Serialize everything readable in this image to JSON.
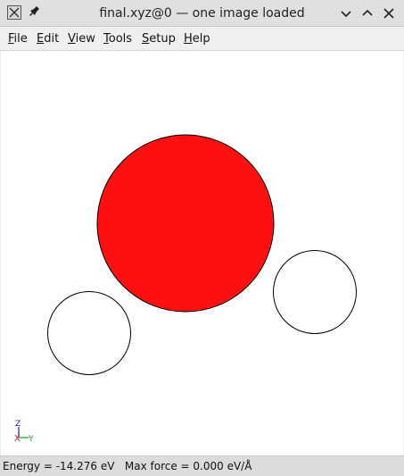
{
  "window": {
    "title": "final.xyz@0 — one image loaded",
    "app_icon": "ase-app-icon",
    "pin_icon": "pin-icon"
  },
  "menu": {
    "items": [
      {
        "label": "File",
        "mnemonic": "F"
      },
      {
        "label": "Edit",
        "mnemonic": "E"
      },
      {
        "label": "View",
        "mnemonic": "V"
      },
      {
        "label": "Tools",
        "mnemonic": "T"
      },
      {
        "label": "Setup",
        "mnemonic": "S"
      },
      {
        "label": "Help",
        "mnemonic": "H"
      }
    ]
  },
  "viewer": {
    "atoms": [
      {
        "element": "O",
        "color": "#ff1010"
      },
      {
        "element": "H",
        "color": "#ffffff"
      },
      {
        "element": "H",
        "color": "#ffffff"
      }
    ],
    "axes": {
      "z": "Z",
      "x": "X",
      "y": "Y",
      "z_color": "#2020c0",
      "x_color": "#d02020",
      "y_color": "#20a020"
    }
  },
  "status": {
    "energy": "Energy = -14.276 eV",
    "max_force": "Max force = 0.000 eV/Å"
  }
}
